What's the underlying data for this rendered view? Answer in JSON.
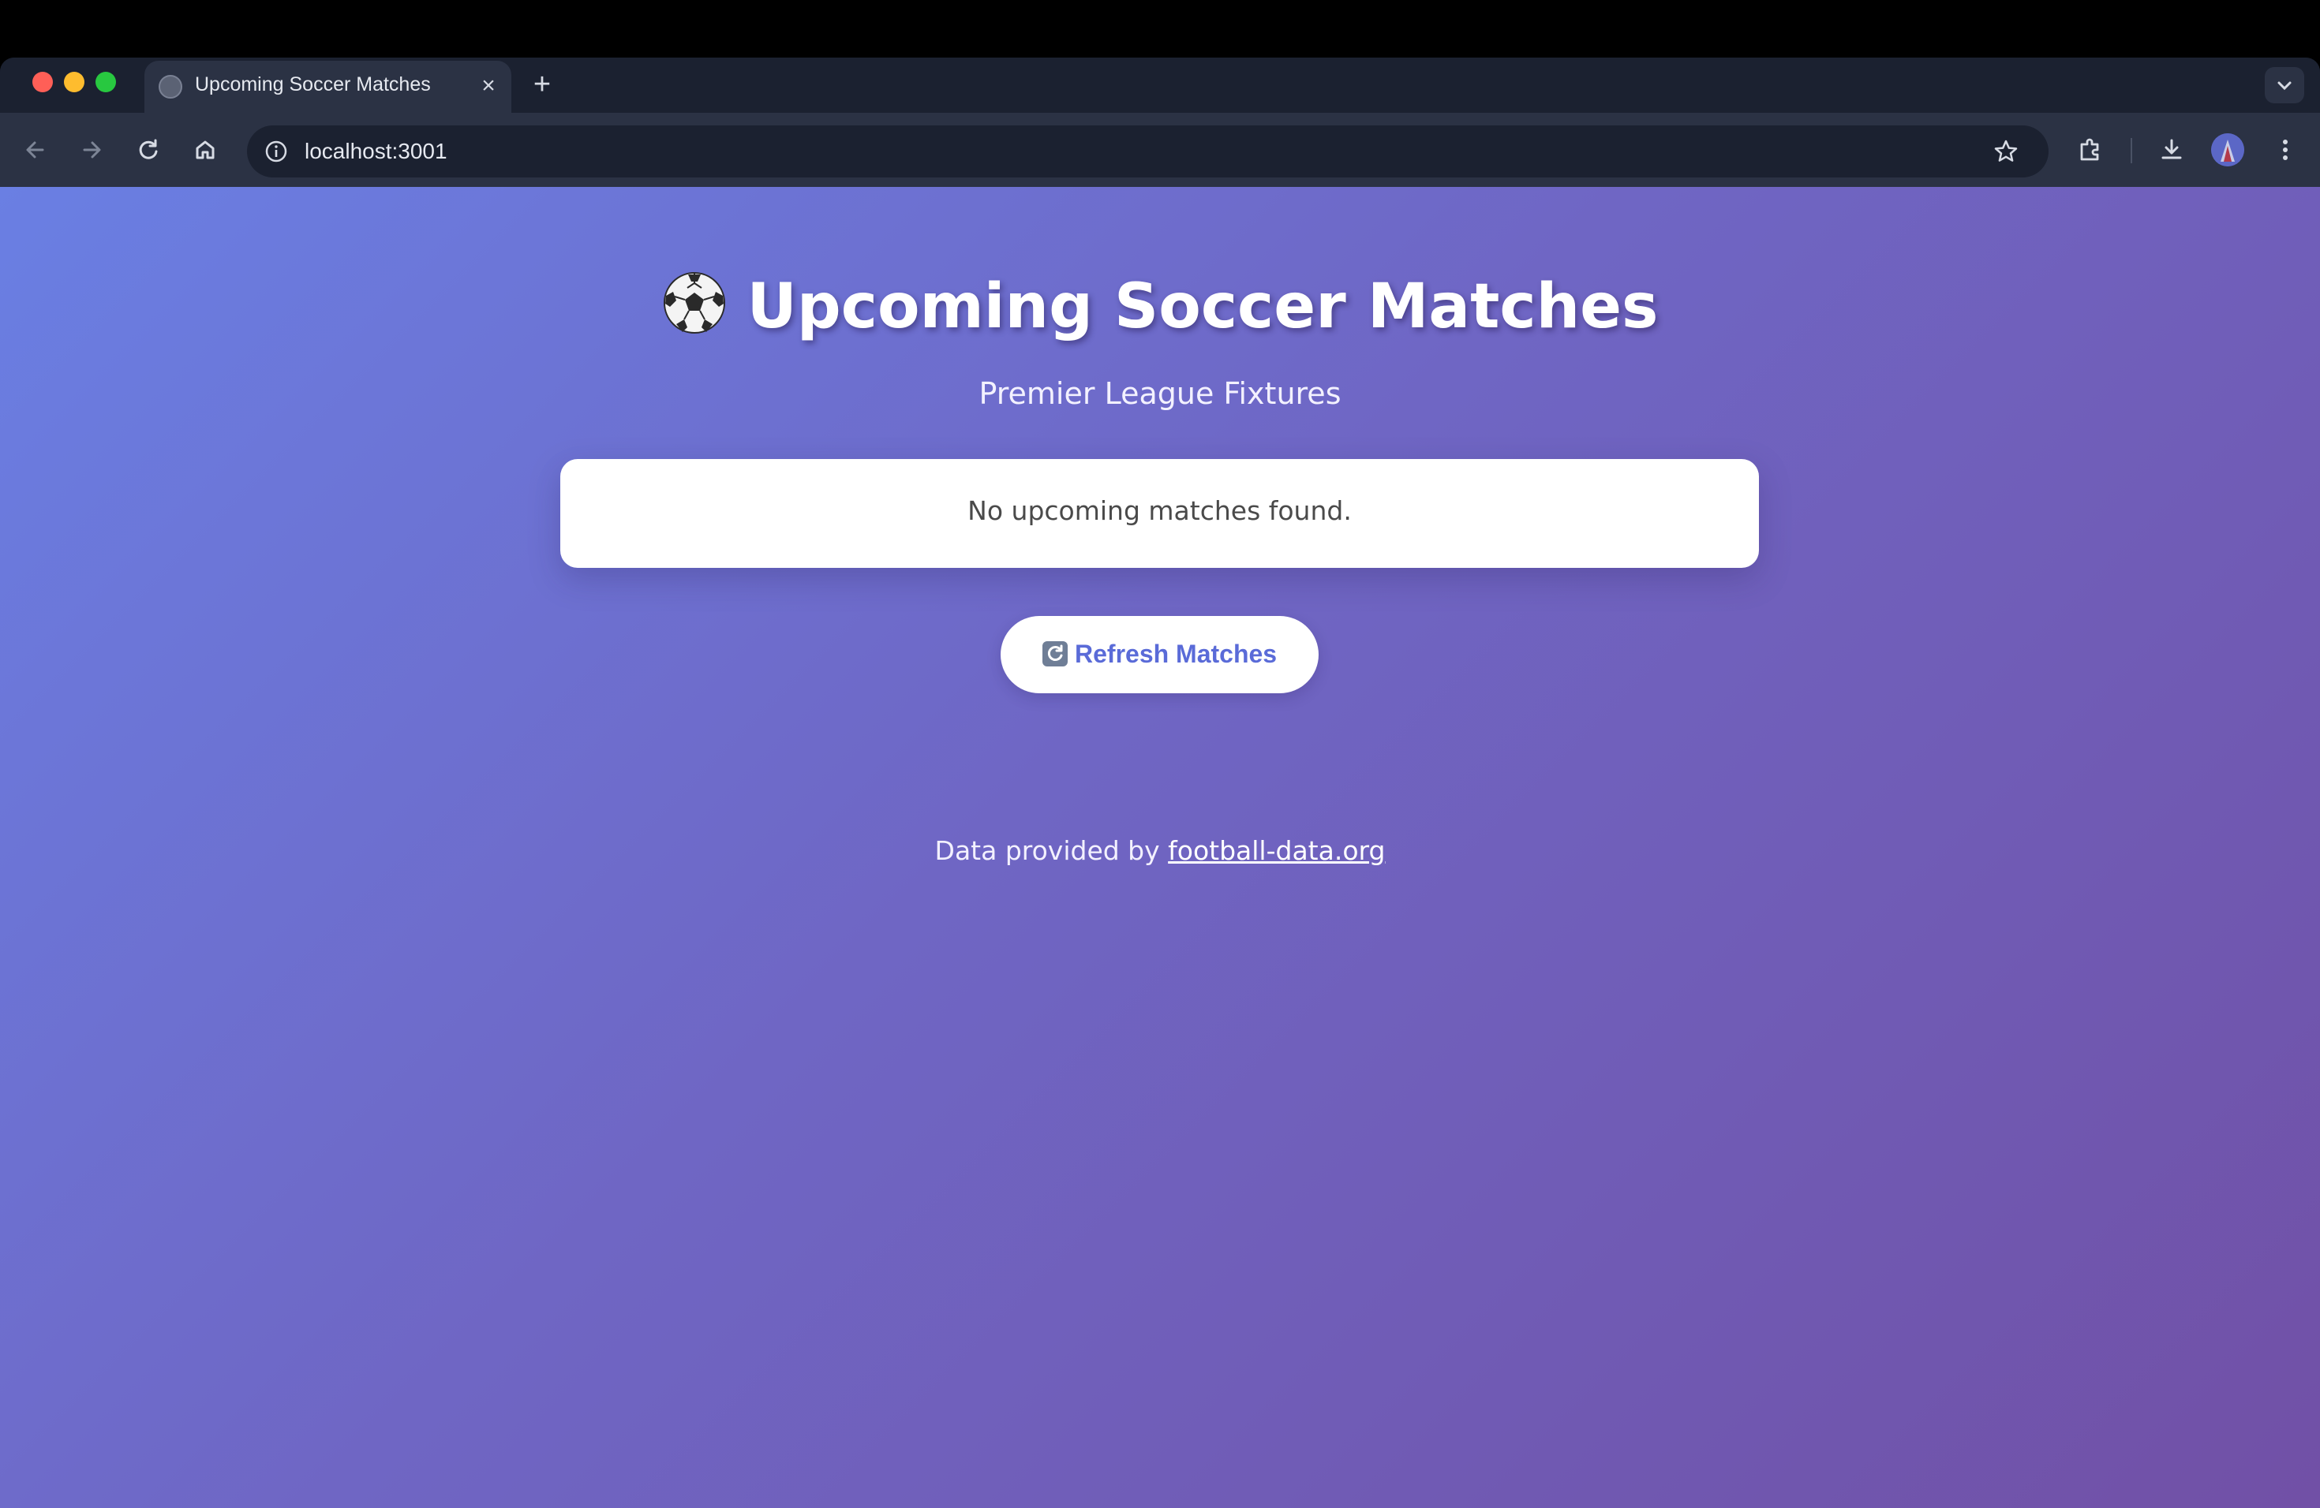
{
  "browser": {
    "tab_title": "Upcoming Soccer Matches",
    "tab_close": "×",
    "new_tab": "+",
    "url": "localhost:3001"
  },
  "page": {
    "title": "Upcoming Soccer Matches",
    "title_icon": "soccer-ball-icon",
    "subtitle": "Premier League Fixtures",
    "empty_message": "No upcoming matches found.",
    "refresh_button": "Refresh Matches",
    "refresh_icon": "refresh-icon",
    "footer_prefix": "Data provided by",
    "footer_link": "football-data.org"
  },
  "colors": {
    "gradient_start": "#6a7fe3",
    "gradient_end": "#7150a6",
    "button_text": "#5a6bd8"
  }
}
